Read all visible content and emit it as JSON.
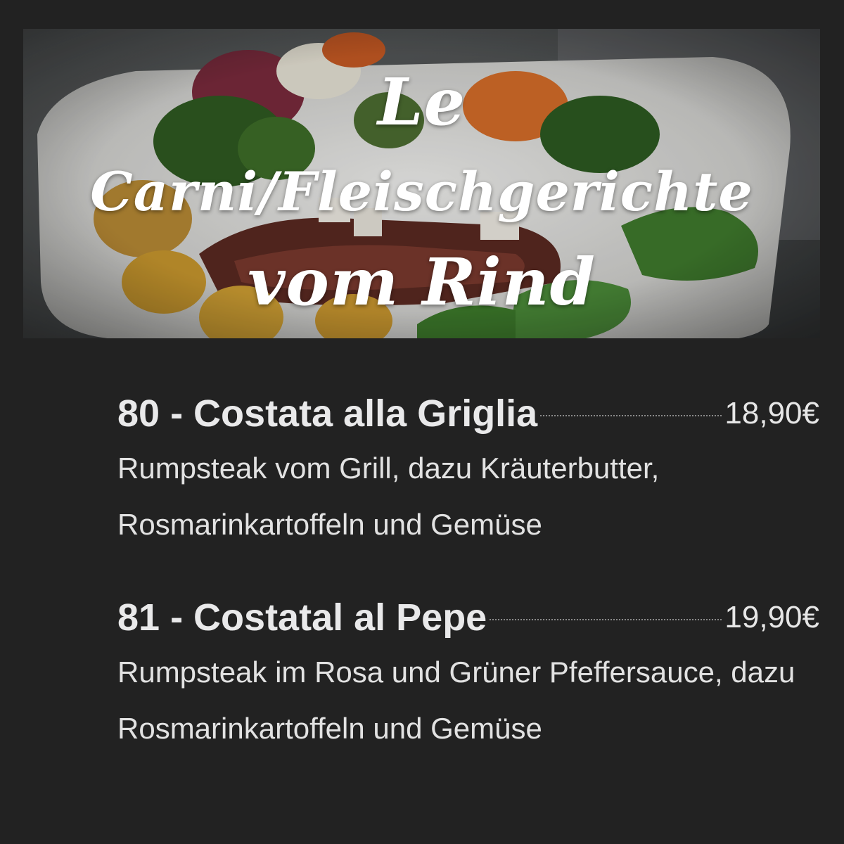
{
  "header": {
    "title_line_1": "Le",
    "title_line_2": "Carni/Fleischgerichte",
    "title_line_3": "vom Rind"
  },
  "menu": {
    "items": [
      {
        "name": "80 - Costata alla Griglia",
        "price": "18,90€",
        "description": "Rumpsteak vom Grill, dazu Kräuterbutter, Rosmarinkartoffeln und Gemüse"
      },
      {
        "name": "81 - Costatal al Pepe",
        "price": "19,90€",
        "description": "Rumpsteak im Rosa und Grüner Pfeffersauce, dazu Rosmarinkartoffeln und Gemüse"
      }
    ]
  },
  "colors": {
    "background": "#222222",
    "text": "#ececec"
  }
}
